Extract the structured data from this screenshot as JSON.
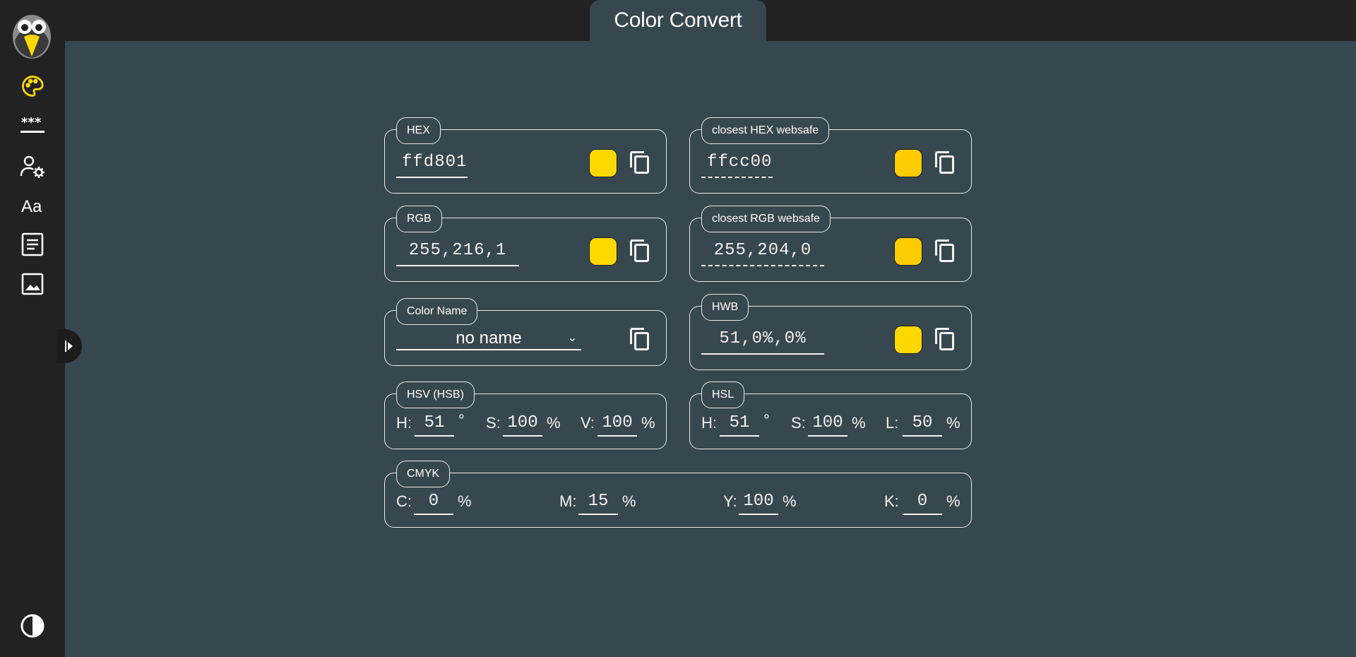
{
  "app": {
    "title": "Color Convert"
  },
  "sidebar": {
    "items": [
      {
        "name": "palette-icon",
        "active": true
      },
      {
        "name": "password-icon"
      },
      {
        "name": "user-settings-icon"
      },
      {
        "name": "font-icon"
      },
      {
        "name": "document-icon"
      },
      {
        "name": "image-icon"
      }
    ],
    "bottom": {
      "name": "contrast-toggle-icon"
    }
  },
  "colors": {
    "accent": "#ffd801",
    "websafe": "#ffcc00",
    "background": "#37474f",
    "sidebar": "#222222"
  },
  "hex": {
    "label": "HEX",
    "value": "ffd801",
    "swatch": "#ffd801"
  },
  "hex_websafe": {
    "label": "closest HEX websafe",
    "value": "ffcc00",
    "swatch": "#ffcc00"
  },
  "rgb": {
    "label": "RGB",
    "value": "255,216,1",
    "swatch": "#ffd801"
  },
  "rgb_websafe": {
    "label": "closest RGB websafe",
    "value": "255,204,0",
    "swatch": "#ffcc00"
  },
  "color_name": {
    "label": "Color Name",
    "value": "no name"
  },
  "hwb": {
    "label": "HWB",
    "value": "51,0%,0%",
    "swatch": "#ffd801"
  },
  "hsv": {
    "label": "HSV (HSB)",
    "h_label": "H:",
    "h": "51",
    "h_unit": "°",
    "s_label": "S:",
    "s": "100",
    "s_unit": "%",
    "v_label": "V:",
    "v": "100",
    "v_unit": "%"
  },
  "hsl": {
    "label": "HSL",
    "h_label": "H:",
    "h": "51",
    "h_unit": "°",
    "s_label": "S:",
    "s": "100",
    "s_unit": "%",
    "l_label": "L:",
    "l": "50",
    "l_unit": "%"
  },
  "cmyk": {
    "label": "CMYK",
    "c_label": "C:",
    "c": "0",
    "c_unit": "%",
    "m_label": "M:",
    "m": "15",
    "m_unit": "%",
    "y_label": "Y:",
    "y": "100",
    "y_unit": "%",
    "k_label": "K:",
    "k": "0",
    "k_unit": "%"
  }
}
